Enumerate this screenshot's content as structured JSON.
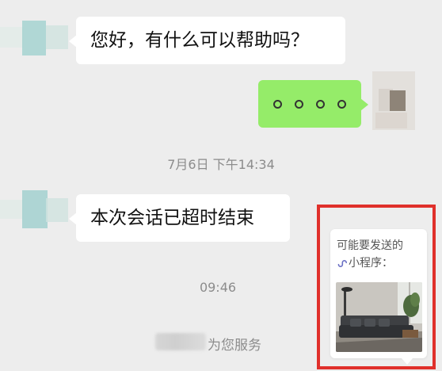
{
  "chat": {
    "messages": [
      {
        "sender": "service",
        "text": "您好，有什么可以帮助吗？"
      },
      {
        "sender": "user",
        "text": "。。。。"
      },
      {
        "sender": "service",
        "text": "本次会话已超时结束"
      }
    ],
    "timestamps": [
      "7月6日 下午14:34",
      "09:46"
    ],
    "service_text": "为您服务"
  },
  "popup": {
    "title": "可能要发送的",
    "subtitle": "小程序：",
    "icon": "mini-program-icon",
    "thumbnail": "sofa-living-room-image"
  },
  "colors": {
    "background": "#ededed",
    "incoming_bubble": "#ffffff",
    "outgoing_bubble": "#95ec69",
    "highlight_border": "#e0302b",
    "timestamp_text": "#8c8c8c"
  }
}
